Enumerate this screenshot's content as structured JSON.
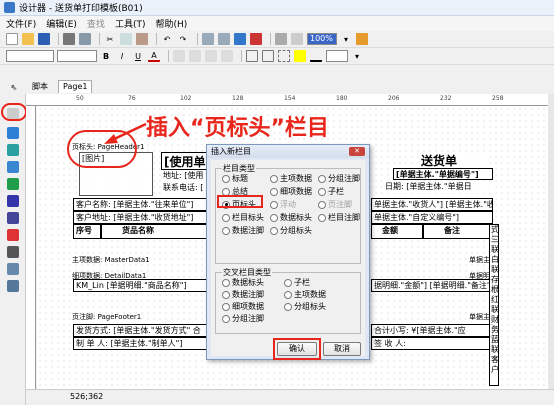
{
  "window": {
    "title": "设计器 - 送货单打印模板(B01)"
  },
  "menu": [
    "文件(F)",
    "编辑(E)",
    "查找",
    "工具(T)",
    "帮助(H)"
  ],
  "toolbar2": {
    "font_size": "100%"
  },
  "tabs": [
    "脚本",
    "Page1"
  ],
  "ruler": [
    "50",
    "76",
    "102",
    "128",
    "154",
    "180",
    "206",
    "232",
    "258"
  ],
  "annotation": "插入“页标头”栏目",
  "bands": {
    "page_header": "页标头: PageHeader1",
    "master_data": "主项数据: MasterData1",
    "detail_data": "细项数据: DetailData1",
    "page_footer": "页注脚: PageFooter1"
  },
  "report": {
    "logo_text": "[图片]",
    "use_unit": "[使用单",
    "title": "送货单",
    "address": "地址: [使用",
    "phone": "联系电话: [",
    "doc_no": "[单据主体.\"单据编号\"]",
    "date": "日期: [单据主体.\"单据日",
    "customer_name": "客户名称: [单据主体.\"往来单位\"]",
    "receiver": "单据主体.\"收货人\"] [单据主体.\"收",
    "customer_address": "客户地址: [单据主体.\"收货地址\"]",
    "custom_no": "单据主体.\"自定义编号\"]",
    "col_no": "序号",
    "col_name": "货品名称",
    "col_amount": "金额",
    "col_remark": "备注",
    "detail_line": "KM_Lin [单据明细.\"商品名称\"]",
    "detail_amount": "据明细.\"金额\"] [单据明细.\"备注\"]",
    "footer_ship": "发货方式: [单据主体.\"发货方式\" 合",
    "footer_maker": "制 单 人: [单据主体.\"制单人\"]",
    "footer_total": "合计小写: ¥[单据主体.\"应",
    "footer_sign": "签 收 人:",
    "side_text": "式 三 联 白 联 存 根 红 联 财 务 蓝 联 客 户",
    "master_detail": "单据主",
    "detail_detail": "单据明",
    "footer_detail": "单据主"
  },
  "status": {
    "coords": "526;362"
  },
  "dialog": {
    "title": "插入新栏目",
    "section_basic": "栏目类型",
    "section_cross": "交叉栏目类型",
    "basic_items": [
      {
        "label": "标题",
        "state": "normal"
      },
      {
        "label": "主项数据",
        "state": "normal"
      },
      {
        "label": "分组注脚",
        "state": "normal"
      },
      {
        "label": "总结",
        "state": "normal"
      },
      {
        "label": "细项数据",
        "state": "normal"
      },
      {
        "label": "子栏",
        "state": "normal"
      },
      {
        "label": "页标头",
        "state": "selected"
      },
      {
        "label": "浮动",
        "state": "disabled"
      },
      {
        "label": "页注脚",
        "state": "disabled"
      },
      {
        "label": "栏目标头",
        "state": "normal"
      },
      {
        "label": "数据标头",
        "state": "normal"
      },
      {
        "label": "栏目注脚",
        "state": "normal"
      },
      {
        "label": "数据注脚",
        "state": "normal"
      },
      {
        "label": "分组标头",
        "state": "normal"
      }
    ],
    "cross_items": [
      {
        "label": "数据标头",
        "state": "normal"
      },
      {
        "label": "子栏",
        "state": "normal"
      },
      {
        "label": "数据注脚",
        "state": "normal"
      },
      {
        "label": "主项数据",
        "state": "normal"
      },
      {
        "label": "细项数据",
        "state": "normal"
      },
      {
        "label": "分组标头",
        "state": "normal"
      },
      {
        "label": "分组注脚",
        "state": "normal"
      }
    ],
    "ok_label": "确认",
    "cancel_label": "取消"
  },
  "colors": {
    "accent_red": "#e8261b",
    "dialog_border": "#7a98c0"
  }
}
